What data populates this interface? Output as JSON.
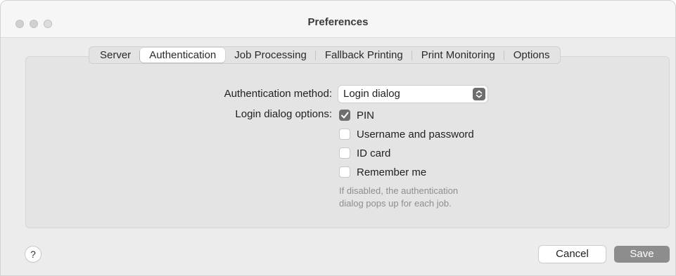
{
  "window": {
    "title": "Preferences"
  },
  "tabs": [
    {
      "label": "Server",
      "active": false
    },
    {
      "label": "Authentication",
      "active": true
    },
    {
      "label": "Job Processing",
      "active": false
    },
    {
      "label": "Fallback Printing",
      "active": false
    },
    {
      "label": "Print Monitoring",
      "active": false
    },
    {
      "label": "Options",
      "active": false
    }
  ],
  "form": {
    "auth_method_label": "Authentication method:",
    "auth_method_value": "Login dialog",
    "login_options_label": "Login dialog options:",
    "options": [
      {
        "label": "PIN",
        "checked": true
      },
      {
        "label": "Username and password",
        "checked": false
      },
      {
        "label": "ID card",
        "checked": false
      },
      {
        "label": "Remember me",
        "checked": false
      }
    ],
    "hint_line1": "If disabled, the authentication",
    "hint_line2": "dialog pops up for each job."
  },
  "footer": {
    "help_label": "?",
    "cancel_label": "Cancel",
    "save_label": "Save"
  },
  "icons": {
    "select_chevron": "chevron-up-down-icon",
    "checkmark": "checkmark-icon"
  },
  "colors": {
    "accent": "#6e6e6e",
    "save_button": "#8d8d8d"
  }
}
